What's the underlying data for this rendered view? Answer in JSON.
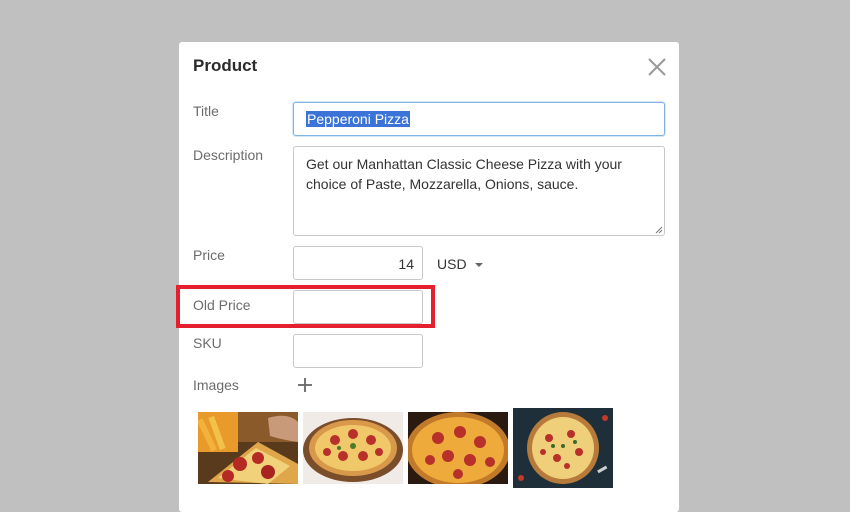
{
  "dialog": {
    "title": "Product",
    "close_icon": "close-icon"
  },
  "form": {
    "title_label": "Title",
    "title_value": "Pepperoni Pizza",
    "description_label": "Description",
    "description_value": "Get our Manhattan Classic Cheese Pizza with your choice of Paste, Mozzarella, Onions, sauce.",
    "price_label": "Price",
    "price_value": "14",
    "currency": "USD",
    "old_price_label": "Old Price",
    "old_price_value": "",
    "sku_label": "SKU",
    "sku_value": "",
    "images_label": "Images",
    "add_image_icon": "plus-icon",
    "images": [
      "pizza-slice-image",
      "pizza-on-board-image",
      "pepperoni-pizza-image",
      "pizza-dark-table-image"
    ]
  },
  "highlight_color": "#e5202e",
  "selection_color": "#3b73d6"
}
